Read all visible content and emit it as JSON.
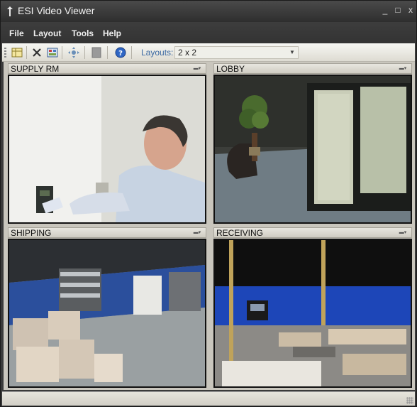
{
  "window": {
    "title": "ESI Video Viewer",
    "controls": {
      "minimize": "_",
      "maximize": "□",
      "close": "x"
    }
  },
  "menu": {
    "items": [
      {
        "label": "File"
      },
      {
        "label": "Layout"
      },
      {
        "label": "Tools"
      },
      {
        "label": "Help"
      }
    ]
  },
  "toolbar": {
    "layouts_label": "Layouts:",
    "layout_value": "2 x 2",
    "buttons": [
      "grid-icon",
      "delete-icon",
      "layout-icon",
      "ptz-icon",
      "blank-icon",
      "help-icon"
    ]
  },
  "cameras": [
    {
      "name": "SUPPLY RM"
    },
    {
      "name": "LOBBY"
    },
    {
      "name": "SHIPPING"
    },
    {
      "name": "RECEIVING"
    }
  ],
  "colors": {
    "titlebar": "#2e2e2e",
    "toolbar_label": "#3c6aa3",
    "pane_bg": "#c9c6bd"
  }
}
